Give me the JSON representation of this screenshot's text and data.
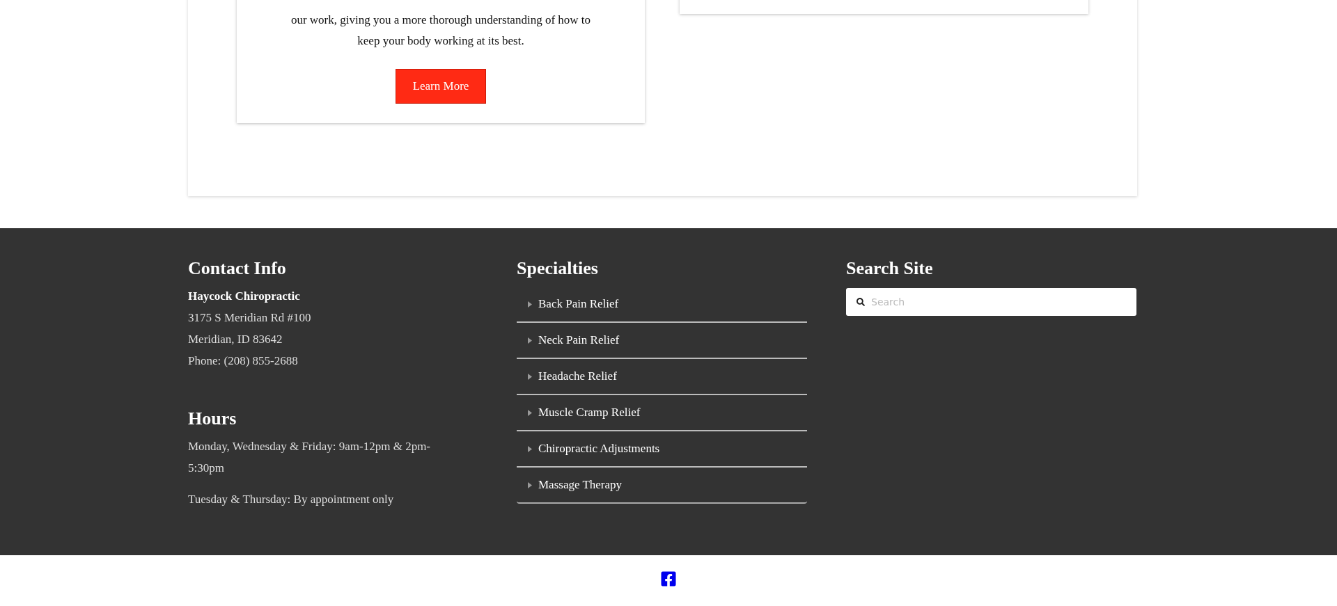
{
  "card": {
    "text": "our work, giving you a more thorough understanding of how to keep your body working at its best.",
    "button": "Learn More"
  },
  "footer": {
    "contact": {
      "title": "Contact Info",
      "name": "Haycock Chiropractic",
      "lines": [
        "3175 S Meridian Rd #100",
        "Meridian, ID 83642",
        "Phone: (208) 855-2688"
      ]
    },
    "hours": {
      "title": "Hours",
      "lines": [
        "Monday, Wednesday & Friday: 9am-12pm & 2pm-5:30pm",
        "Tuesday & Thursday: By appointment only"
      ]
    },
    "specialties": {
      "title": "Specialties",
      "items": [
        {
          "label": "Back Pain Relief",
          "expanded": false
        },
        {
          "label": "Neck Pain Relief",
          "expanded": false
        },
        {
          "label": "Headache Relief",
          "expanded": false
        },
        {
          "label": "Muscle Cramp Relief",
          "expanded": false
        },
        {
          "label": "Chiropractic Adjustments",
          "expanded": false
        },
        {
          "label": "Massage Therapy",
          "expanded": false
        }
      ]
    },
    "search": {
      "title": "Search Site",
      "placeholder": "Search"
    }
  }
}
